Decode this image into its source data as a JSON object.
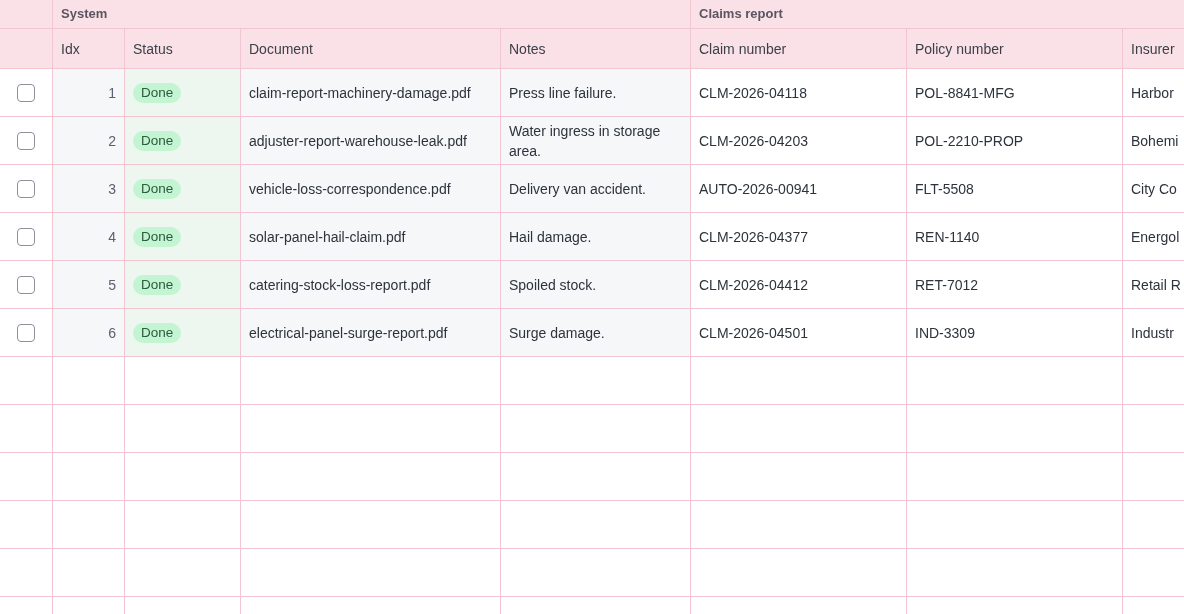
{
  "column_groups": [
    {
      "label": "System",
      "kind": "system",
      "columns": [
        {
          "label": "Idx",
          "kind": "index"
        },
        {
          "label": "Status",
          "kind": "status"
        },
        {
          "label": "Document",
          "kind": "text"
        },
        {
          "label": "Notes",
          "kind": "text"
        }
      ]
    },
    {
      "label": "Claims report",
      "kind": "report",
      "columns": [
        {
          "label": "Claim number",
          "kind": "text"
        },
        {
          "label": "Policy number",
          "kind": "text"
        },
        {
          "label": "Insurer",
          "kind": "text"
        }
      ]
    }
  ],
  "rows": [
    {
      "checked": false,
      "cells": [
        "1",
        "Done",
        "claim-report-machinery-damage.pdf",
        "Press line failure.",
        "CLM-2026-04118",
        "POL-8841-MFG",
        "Harbor"
      ]
    },
    {
      "checked": false,
      "cells": [
        "2",
        "Done",
        "adjuster-report-warehouse-leak.pdf",
        "Water ingress in storage area.",
        "CLM-2026-04203",
        "POL-2210-PROP",
        "Bohemi"
      ]
    },
    {
      "checked": false,
      "cells": [
        "3",
        "Done",
        "vehicle-loss-correspondence.pdf",
        "Delivery van accident.",
        "AUTO-2026-00941",
        "FLT-5508",
        "City Co"
      ]
    },
    {
      "checked": false,
      "cells": [
        "4",
        "Done",
        "solar-panel-hail-claim.pdf",
        "Hail damage.",
        "CLM-2026-04377",
        "REN-1140",
        "Energol"
      ]
    },
    {
      "checked": false,
      "cells": [
        "5",
        "Done",
        "catering-stock-loss-report.pdf",
        "Spoiled stock.",
        "CLM-2026-04412",
        "RET-7012",
        "Retail R"
      ]
    },
    {
      "checked": false,
      "cells": [
        "6",
        "Done",
        "electrical-panel-surge-report.pdf",
        "Surge damage.",
        "CLM-2026-04501",
        "IND-3309",
        "Industr"
      ]
    }
  ]
}
